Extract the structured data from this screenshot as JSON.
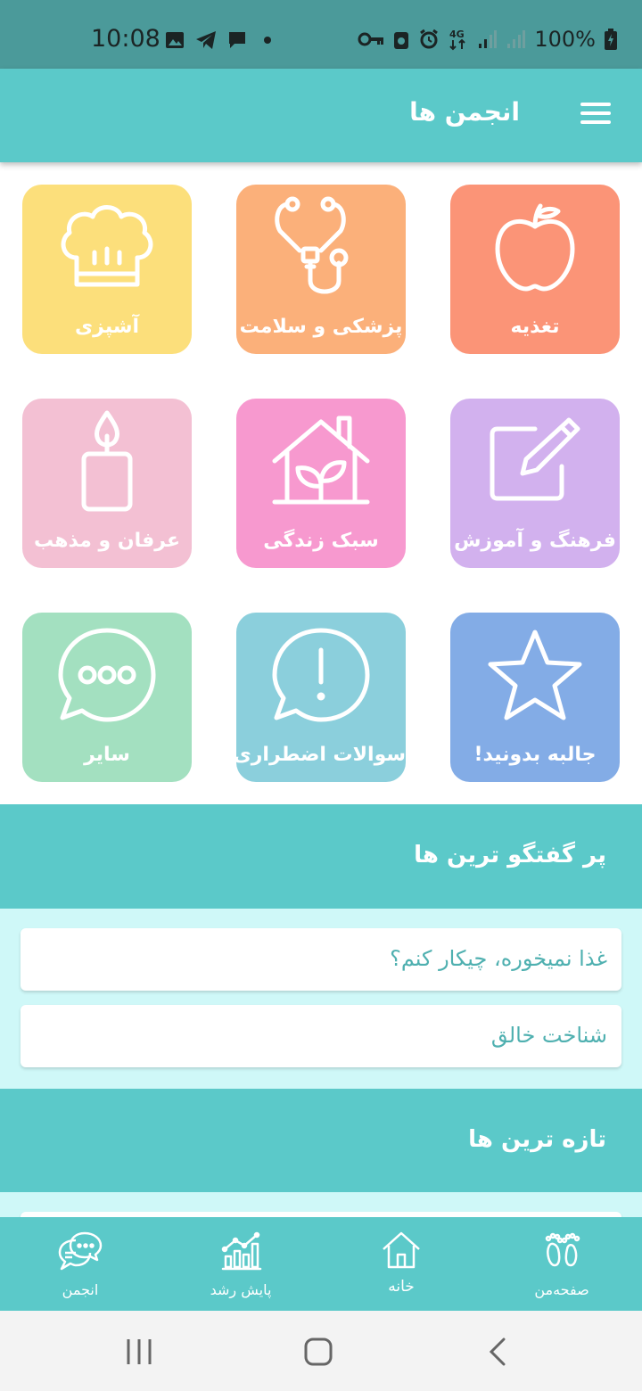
{
  "status": {
    "time": "10:08",
    "battery": "100%",
    "network": "4G"
  },
  "header": {
    "title": "انجمن ها",
    "menu_icon": "hamburger-menu-icon"
  },
  "categories": [
    {
      "label": "تغذیه",
      "icon": "apple-icon",
      "color": "#fb9477"
    },
    {
      "label": "پزشکی و سلامت",
      "icon": "stethoscope-icon",
      "color": "#fbb07a"
    },
    {
      "label": "آشپزی",
      "icon": "chef-hat-icon",
      "color": "#fcdf7b"
    },
    {
      "label": "فرهنگ و آموزش",
      "icon": "pencil-edit-icon",
      "color": "#d2b1ee"
    },
    {
      "label": "سبک زندگی",
      "icon": "house-plant-icon",
      "color": "#f799cf"
    },
    {
      "label": "عرفان و مذهب",
      "icon": "candle-icon",
      "color": "#f3c0d3"
    },
    {
      "label": "جالبه بدونید!",
      "icon": "star-icon",
      "color": "#83ace6"
    },
    {
      "label": "سوالات اضطراری",
      "icon": "alert-chat-icon",
      "color": "#8bcfdc"
    },
    {
      "label": "سایر",
      "icon": "chat-dots-icon",
      "color": "#a3e0c0"
    }
  ],
  "popular": {
    "title": "پر گفتگو ترین ها",
    "items": [
      "غذا نمیخوره، چیکار کنم؟",
      "شناخت خالق"
    ]
  },
  "latest": {
    "title": "تازه ترین ها"
  },
  "bottom_nav": [
    {
      "label": "صفحه‌من",
      "icon": "baby-feet-icon"
    },
    {
      "label": "خانه",
      "icon": "home-icon"
    },
    {
      "label": "پایش رشد",
      "icon": "growth-chart-icon"
    },
    {
      "label": "انجمن",
      "icon": "forum-chat-icon"
    }
  ],
  "colors": {
    "primary": "#5bc9c9",
    "status_bar": "#4b9a9a",
    "list_bg": "#cff8f8",
    "list_text": "#4fb0b0"
  }
}
